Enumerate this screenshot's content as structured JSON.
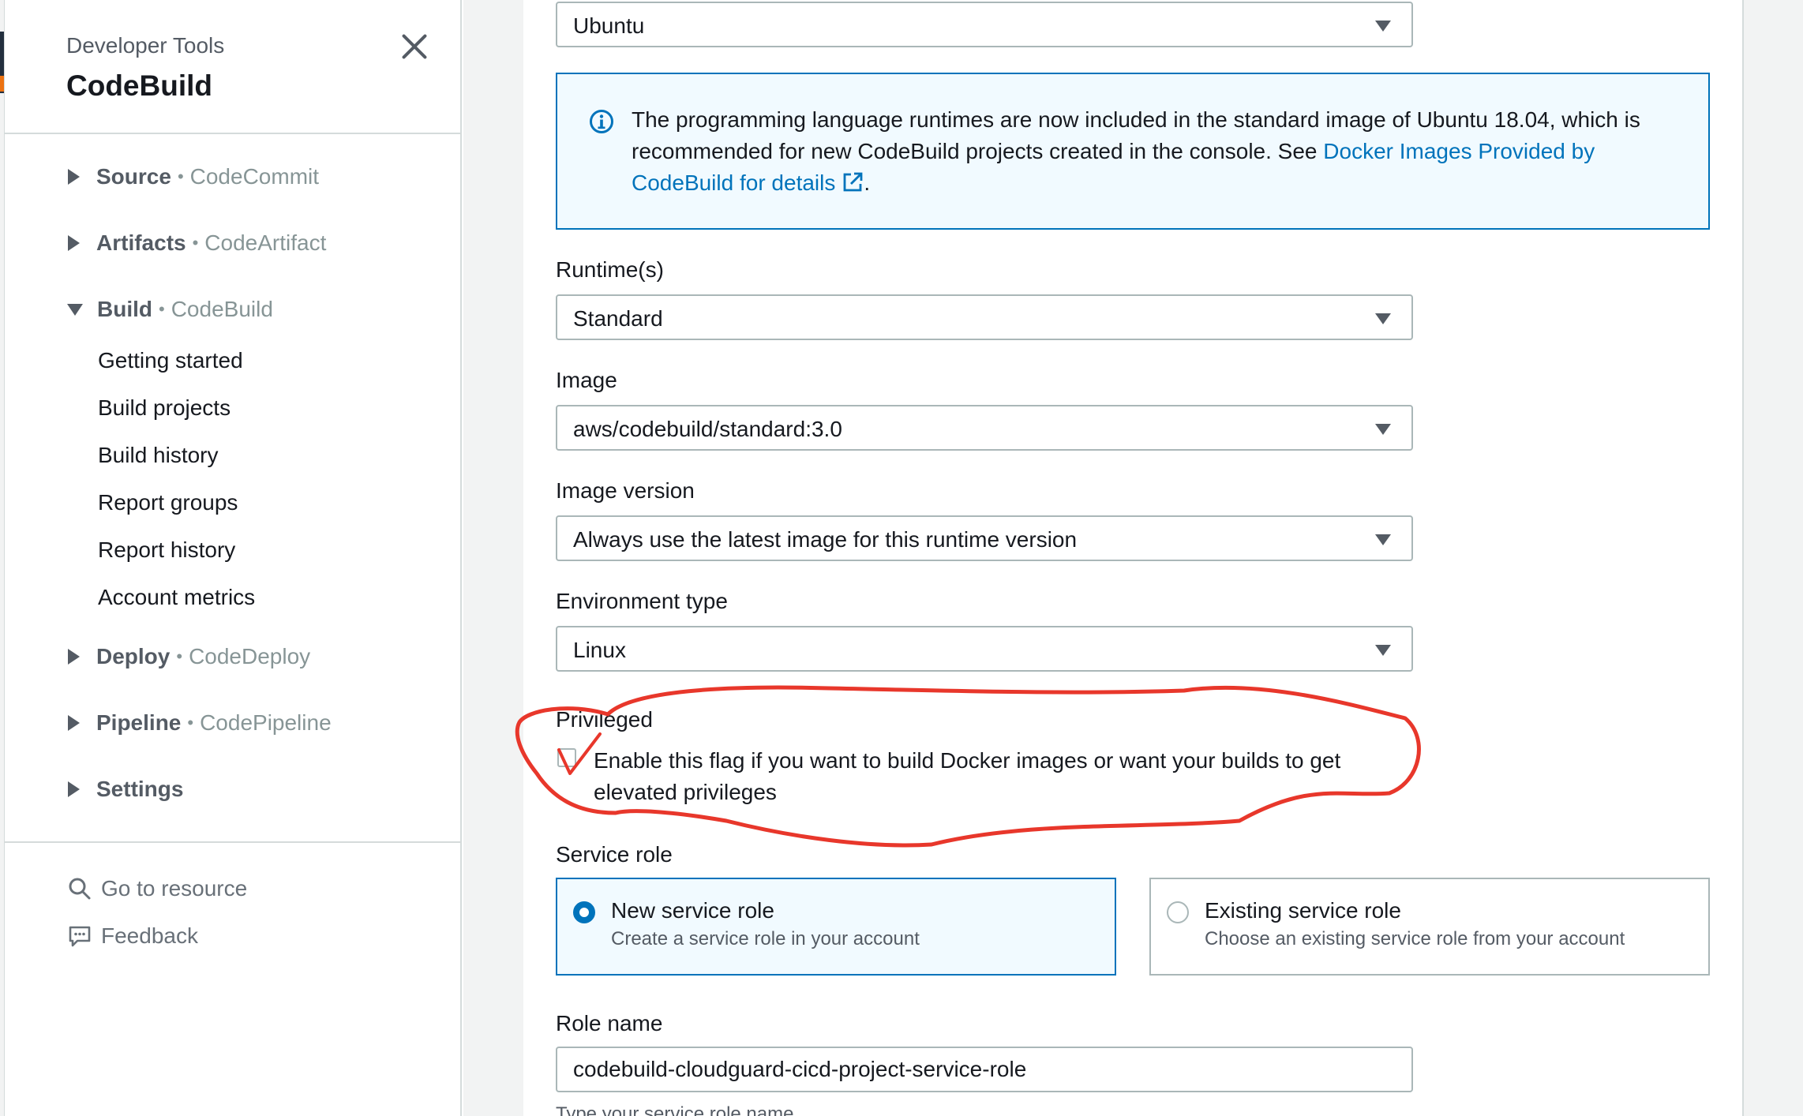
{
  "sidebar": {
    "super_title": "Developer Tools",
    "title": "CodeBuild",
    "groups": [
      {
        "main": "Source",
        "sub": "CodeCommit"
      },
      {
        "main": "Artifacts",
        "sub": "CodeArtifact"
      },
      {
        "main": "Build",
        "sub": "CodeBuild"
      },
      {
        "main": "Deploy",
        "sub": "CodeDeploy"
      },
      {
        "main": "Pipeline",
        "sub": "CodePipeline"
      },
      {
        "main": "Settings",
        "sub": ""
      }
    ],
    "separator": "•",
    "build_items": [
      "Getting started",
      "Build projects",
      "Build history",
      "Report groups",
      "Report history",
      "Account metrics"
    ],
    "utilities": {
      "go_to_resource": "Go to resource",
      "feedback": "Feedback"
    }
  },
  "form": {
    "os_value": "Ubuntu",
    "info": {
      "text": "The programming language runtimes are now included in the standard image of Ubuntu 18.04, which is recommended for new CodeBuild projects created in the console. See ",
      "link": "Docker Images Provided by CodeBuild for details",
      "end": "."
    },
    "runtime_label": "Runtime(s)",
    "runtime_value": "Standard",
    "image_label": "Image",
    "image_value": "aws/codebuild/standard:3.0",
    "image_version_label": "Image version",
    "image_version_value": "Always use the latest image for this runtime version",
    "env_type_label": "Environment type",
    "env_type_value": "Linux",
    "privileged_label": "Privileged",
    "privileged_text": "Enable this flag if you want to build Docker images or want your builds to get elevated privileges",
    "privileged_checked": false,
    "service_role_label": "Service role",
    "service_role_options": [
      {
        "title": "New service role",
        "desc": "Create a service role in your account",
        "selected": true
      },
      {
        "title": "Existing service role",
        "desc": "Choose an existing service role from your account",
        "selected": false
      }
    ],
    "role_name_label": "Role name",
    "role_name_value": "codebuild-cloudguard-cicd-project-service-role",
    "role_name_hint": "Type your service role name"
  },
  "colors": {
    "accent": "#0073bb",
    "annotation": "#e8372b",
    "text": "#16191f",
    "muted": "#879596"
  },
  "icons": {
    "close": "close-icon",
    "caret_right": "caret-right-icon",
    "caret_down": "caret-down-icon",
    "info": "info-icon",
    "external_link": "external-link-icon",
    "search": "search-icon",
    "feedback": "feedback-icon",
    "dropdown": "chevron-down-icon"
  }
}
